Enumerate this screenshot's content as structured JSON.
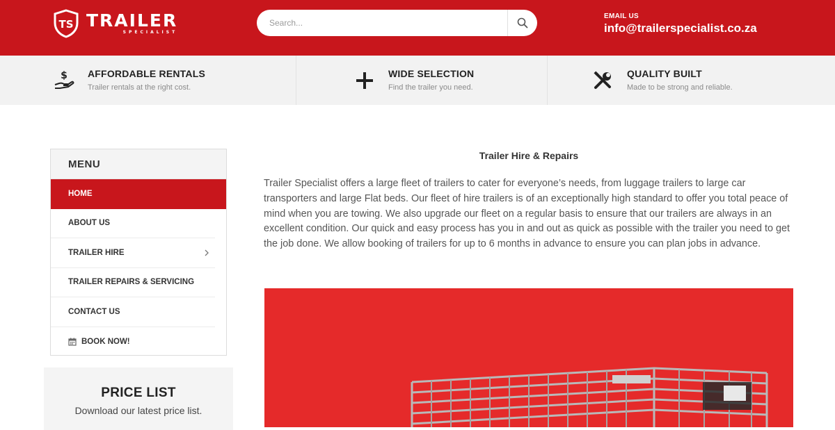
{
  "header": {
    "logo_initials": "TS",
    "logo_main": "TRAILER",
    "logo_sub": "SPECIALIST",
    "search_placeholder": "Search...",
    "email_label": "EMAIL US",
    "email_value": "info@trailerspecialist.co.za"
  },
  "features": [
    {
      "icon": "dollar-hand-icon",
      "title": "AFFORDABLE RENTALS",
      "subtitle": "Trailer rentals at the right cost."
    },
    {
      "icon": "plus-icon",
      "title": "WIDE SELECTION",
      "subtitle": "Find the trailer you need."
    },
    {
      "icon": "tools-icon",
      "title": "QUALITY BUILT",
      "subtitle": "Made to be strong and reliable."
    }
  ],
  "menu": {
    "title": "MENU",
    "items": [
      {
        "label": "HOME",
        "active": true
      },
      {
        "label": "ABOUT US"
      },
      {
        "label": "TRAILER HIRE",
        "icon": "chevron-right-icon"
      },
      {
        "label": "TRAILER REPAIRS & SERVICING"
      },
      {
        "label": "CONTACT US"
      },
      {
        "label": "BOOK NOW!",
        "icon": "calendar-icon"
      }
    ]
  },
  "price_list": {
    "title": "PRICE LIST",
    "subtitle": "Download our latest price list."
  },
  "main": {
    "title": "Trailer Hire & Repairs",
    "body": "Trailer Specialist offers  a large fleet of trailers to cater for everyone’s needs, from luggage trailers to large car transporters and large Flat beds. Our fleet of hire trailers is of an exceptionally high standard to offer you total peace of mind when you are towing. We also upgrade our fleet on a regular basis to ensure that our trailers are always in an excellent condition. Our quick and easy process has you in and out as quick as possible with the trailer you need to get the job done. We allow booking of trailers for up to 6 months in advance to ensure you can plan jobs in advance."
  },
  "colors": {
    "brand_red": "#c8161c",
    "hero_red": "#e52a2a",
    "feature_bar": "#f2f2f2"
  }
}
